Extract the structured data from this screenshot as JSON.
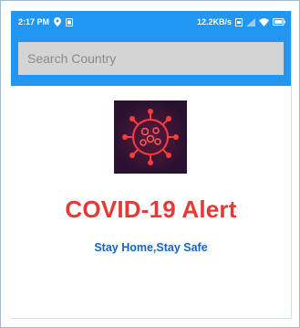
{
  "status_bar": {
    "time": "2:17 PM",
    "network_speed": "12.2KB/s",
    "icons": [
      "location-icon",
      "notification-icon",
      "sim-icon",
      "signal-icon",
      "wifi-icon",
      "battery-icon"
    ]
  },
  "search": {
    "placeholder": "Search Country",
    "value": ""
  },
  "alert": {
    "image": "covid-virus-image",
    "title": "COVID-19 Alert",
    "subtitle": "Stay Home,Stay Safe"
  },
  "colors": {
    "primary": "#2196f3",
    "alert_red": "#e53935",
    "subtitle_blue": "#1565c0"
  }
}
